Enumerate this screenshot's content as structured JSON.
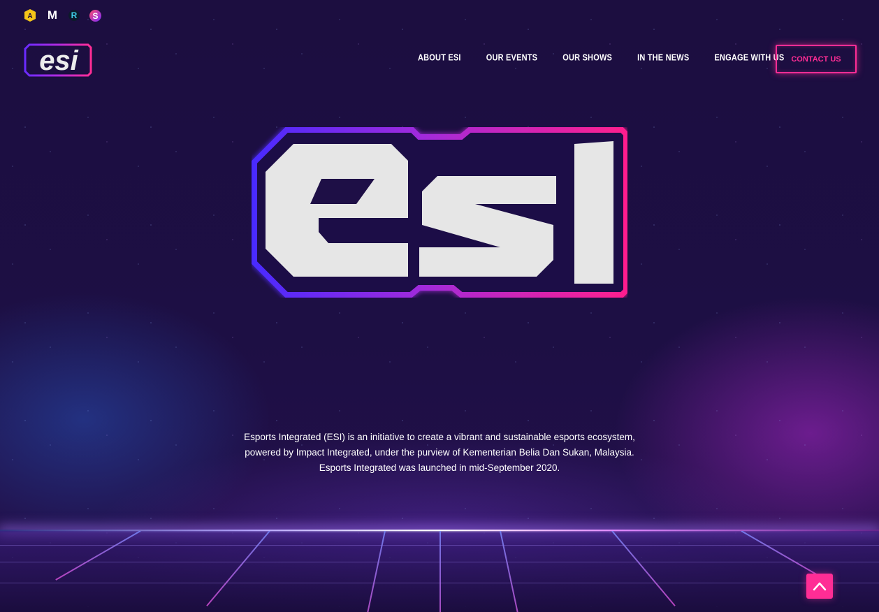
{
  "top_icons": [
    {
      "name": "partner-logo-1-icon",
      "glyph": "A",
      "color": "#f5c518"
    },
    {
      "name": "partner-logo-m-icon",
      "glyph": "M",
      "color": "#ffffff"
    },
    {
      "name": "partner-logo-r-icon",
      "glyph": "R",
      "color": "#3fd0e8"
    },
    {
      "name": "partner-logo-s-icon",
      "glyph": "S",
      "color": "#ff4d6d"
    }
  ],
  "brand": {
    "logo_text": "esi"
  },
  "nav": {
    "items": [
      "ABOUT ESI",
      "OUR EVENTS",
      "OUR SHOWS",
      "IN THE NEWS",
      "ENGAGE WITH US"
    ],
    "contact_label": "CONTACT US"
  },
  "hero": {
    "logo_text": "esi",
    "description": [
      "Esports Integrated (ESI) is an initiative to create a vibrant and sustainable esports ecosystem,",
      "powered by Impact Integrated, under the purview of Kementerian Belia Dan Sukan, Malaysia.",
      "Esports Integrated was launched in mid-September 2020."
    ]
  },
  "colors": {
    "accent": "#ff2d95",
    "background": "#1b0d3d",
    "logo_fill": "#e6e6e6",
    "purple": "#7b2bff"
  },
  "scroll_top_icon": "chevron-up-icon"
}
